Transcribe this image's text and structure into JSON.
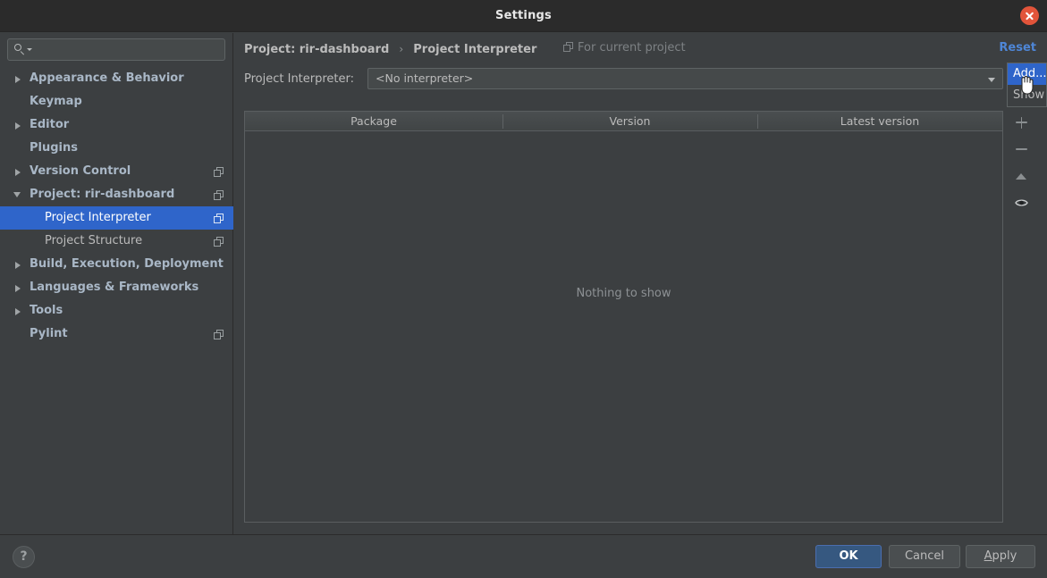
{
  "window": {
    "title": "Settings",
    "close_icon": "close-icon"
  },
  "sidebar": {
    "search": {
      "placeholder": "",
      "value": "",
      "icon": "search-icon"
    },
    "items": [
      {
        "label": "Appearance & Behavior",
        "level": 0,
        "twisty": "collapsed",
        "module_icon": false,
        "selected": false
      },
      {
        "label": "Keymap",
        "level": 0,
        "twisty": "none",
        "module_icon": false,
        "selected": false
      },
      {
        "label": "Editor",
        "level": 0,
        "twisty": "collapsed",
        "module_icon": false,
        "selected": false
      },
      {
        "label": "Plugins",
        "level": 0,
        "twisty": "none",
        "module_icon": false,
        "selected": false
      },
      {
        "label": "Version Control",
        "level": 0,
        "twisty": "collapsed",
        "module_icon": true,
        "selected": false
      },
      {
        "label": "Project: rir-dashboard",
        "level": 0,
        "twisty": "expanded",
        "module_icon": true,
        "selected": false
      },
      {
        "label": "Project Interpreter",
        "level": 1,
        "twisty": "none",
        "module_icon": true,
        "selected": true
      },
      {
        "label": "Project Structure",
        "level": 1,
        "twisty": "none",
        "module_icon": true,
        "selected": false
      },
      {
        "label": "Build, Execution, Deployment",
        "level": 0,
        "twisty": "collapsed",
        "module_icon": false,
        "selected": false
      },
      {
        "label": "Languages & Frameworks",
        "level": 0,
        "twisty": "collapsed",
        "module_icon": false,
        "selected": false
      },
      {
        "label": "Tools",
        "level": 0,
        "twisty": "collapsed",
        "module_icon": false,
        "selected": false
      },
      {
        "label": "Pylint",
        "level": 0,
        "twisty": "none",
        "module_icon": true,
        "selected": false
      }
    ]
  },
  "main": {
    "breadcrumb": {
      "parts": [
        "Project: rir-dashboard",
        "Project Interpreter"
      ],
      "separator": "›"
    },
    "for_current_project": {
      "label": "For current project",
      "icon": "module-icon"
    },
    "reset_link": "Reset",
    "interpreter": {
      "label": "Project Interpreter:",
      "value": "<No interpreter>",
      "dropdown_icon": "chevron-down-icon"
    },
    "popup_menu": {
      "items": [
        {
          "label": "Add...",
          "highlighted": true
        },
        {
          "label": "Show",
          "highlighted": false
        }
      ]
    },
    "packages_table": {
      "columns": [
        "Package",
        "Version",
        "Latest version"
      ],
      "rows": [],
      "empty_message": "Nothing to show"
    },
    "side_toolbar": [
      {
        "name": "add-package-button",
        "icon": "plus-icon"
      },
      {
        "name": "remove-package-button",
        "icon": "minus-icon"
      },
      {
        "name": "upgrade-package-button",
        "icon": "up-triangle-icon"
      },
      {
        "name": "show-early-releases-button",
        "icon": "eye-icon"
      }
    ]
  },
  "footer": {
    "help": "?",
    "buttons": [
      {
        "label": "OK",
        "primary": true
      },
      {
        "label": "Cancel",
        "primary": false
      },
      {
        "label": "Apply",
        "primary": false,
        "mnemonic": "A"
      }
    ]
  },
  "colors": {
    "background": "#3c3f41",
    "titlebar": "#2b2b2b",
    "selection": "#2f65ca",
    "accent_link": "#4e86d6",
    "primary_button": "#365880",
    "close_button": "#e2543a",
    "text": "#bbbbbb",
    "tree_text": "#a9b7c6"
  }
}
